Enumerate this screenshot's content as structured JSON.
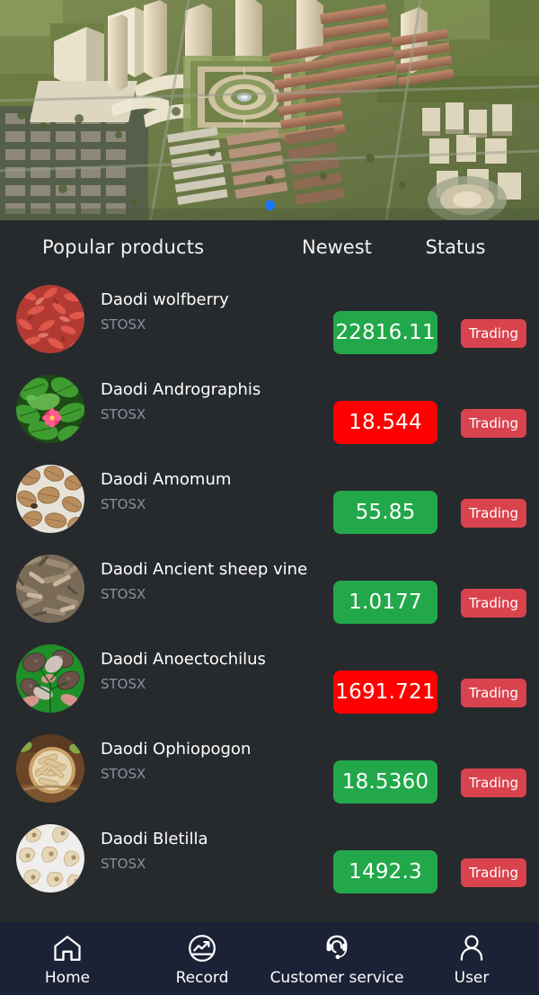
{
  "banner": {
    "alt": "aerial-render-of-planned-industrial-park",
    "carousel_dots": 1,
    "active_dot": 0,
    "dot_color": "#1677ff"
  },
  "list_header": {
    "title": "Popular products",
    "newest": "Newest",
    "status": "Status"
  },
  "colors": {
    "background": "#272a2d",
    "tabbar": "#1c2236",
    "up": "#22a84a",
    "down": "#fe0000",
    "status_badge": "#d9434e",
    "code_text": "#8b8e9e"
  },
  "products": [
    {
      "name": "Daodi wolfberry",
      "code": "STOSX",
      "price": "22816.11",
      "direction": "up",
      "status": "Trading",
      "thumb": "goji-berries-thumb"
    },
    {
      "name": "Daodi Andrographis",
      "code": "STOSX",
      "price": "18.544",
      "direction": "down",
      "status": "Trading",
      "thumb": "green-leaf-flower-thumb"
    },
    {
      "name": "Daodi Amomum",
      "code": "STOSX",
      "price": "55.85",
      "direction": "up",
      "status": "Trading",
      "thumb": "amomum-pods-thumb"
    },
    {
      "name": "Daodi Ancient sheep vine",
      "code": "STOSX",
      "price": "1.0177",
      "direction": "up",
      "status": "Trading",
      "thumb": "dried-vine-slices-thumb"
    },
    {
      "name": "Daodi Anoectochilus",
      "code": "STOSX",
      "price": "1691.721",
      "direction": "down",
      "status": "Trading",
      "thumb": "anoectochilus-plant-thumb"
    },
    {
      "name": "Daodi Ophiopogon",
      "code": "STOSX",
      "price": "18.5360",
      "direction": "up",
      "status": "Trading",
      "thumb": "ophiopogon-roots-thumb"
    },
    {
      "name": "Daodi Bletilla",
      "code": "STOSX",
      "price": "1492.3",
      "direction": "up",
      "status": "Trading",
      "thumb": "bletilla-tubers-thumb"
    }
  ],
  "tabbar": {
    "items": [
      {
        "label": "Home",
        "icon": "home-icon",
        "active": false
      },
      {
        "label": "Record",
        "icon": "chart-circle-icon",
        "active": false
      },
      {
        "label": "Customer service",
        "icon": "headset-support-icon",
        "active": false
      },
      {
        "label": "User",
        "icon": "user-icon",
        "active": false
      }
    ]
  }
}
